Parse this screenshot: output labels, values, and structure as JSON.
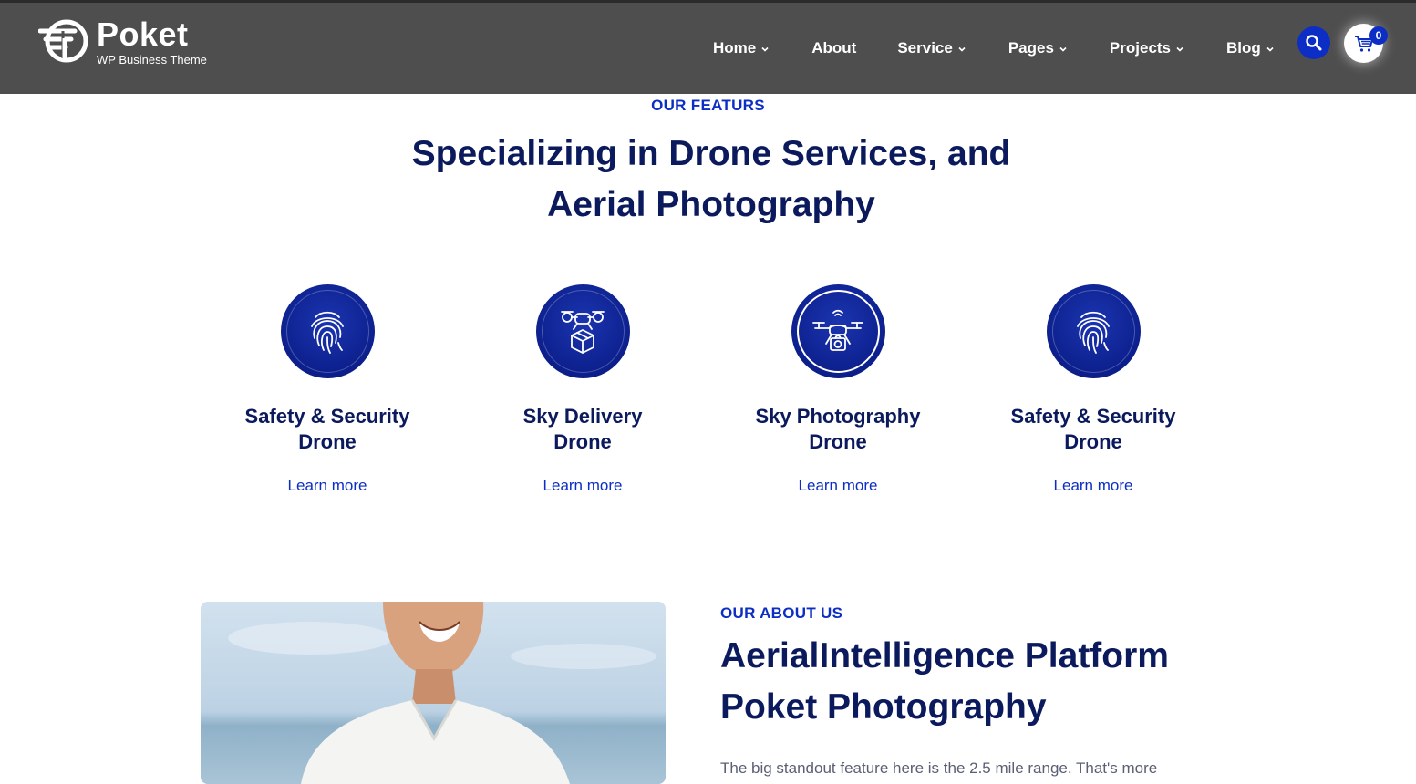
{
  "header": {
    "brand_name": "Poket",
    "brand_tagline": "WP Business Theme",
    "nav": [
      {
        "label": "Home",
        "has_dropdown": true
      },
      {
        "label": "About",
        "has_dropdown": false
      },
      {
        "label": "Service",
        "has_dropdown": true
      },
      {
        "label": "Pages",
        "has_dropdown": true
      },
      {
        "label": "Projects",
        "has_dropdown": true
      },
      {
        "label": "Blog",
        "has_dropdown": true
      }
    ],
    "search_icon": "search-icon",
    "cart_icon": "cart-icon",
    "cart_count": "0"
  },
  "features": {
    "eyebrow": "OUR FEATURS",
    "title_line1": "Specializing in Drone Services, and",
    "title_line2": "Aerial Photography",
    "items": [
      {
        "icon": "fingerprint-icon",
        "title_line1": "Safety & Security",
        "title_line2": "Drone",
        "link": "Learn more"
      },
      {
        "icon": "drone-delivery-icon",
        "title_line1": "Sky Delivery",
        "title_line2": "Drone",
        "link": "Learn more"
      },
      {
        "icon": "drone-camera-icon",
        "title_line1": "Sky Photography",
        "title_line2": "Drone",
        "link": "Learn more"
      },
      {
        "icon": "fingerprint-icon",
        "title_line1": "Safety & Security",
        "title_line2": "Drone",
        "link": "Learn more"
      }
    ]
  },
  "about": {
    "eyebrow": "OUR ABOUT US",
    "title_line1": "AerialIntelligence Platform",
    "title_line2": "Poket Photography",
    "text": "The big standout feature here is the 2.5 mile range. That's more"
  },
  "colors": {
    "header_bg": "#4e4e4e",
    "accent": "#0d2ec4",
    "heading": "#0b1a5c"
  }
}
